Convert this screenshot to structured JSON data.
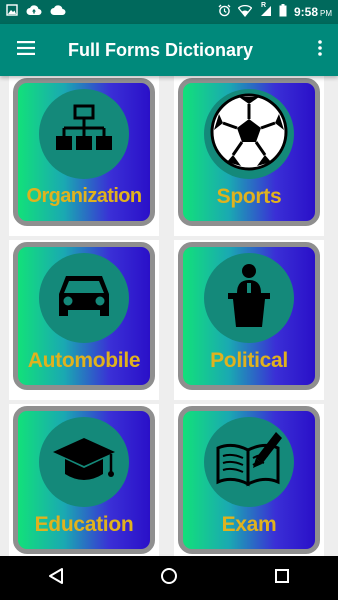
{
  "status_bar": {
    "icons_left": [
      "image-icon",
      "cloud-upload-icon",
      "cloud-icon"
    ],
    "icons_right": [
      "alarm-icon",
      "wifi-icon",
      "signal-icon",
      "battery-icon"
    ],
    "signal_badge": "R",
    "time": "9:58",
    "ampm": "PM"
  },
  "app_bar": {
    "title": "Full Forms Dictionary",
    "menu_icon": "hamburger-menu-icon",
    "overflow_icon": "more-vert-icon"
  },
  "categories": [
    {
      "label": "Organization",
      "icon": "org-chart-icon"
    },
    {
      "label": "Sports",
      "icon": "soccer-ball-icon"
    },
    {
      "label": "Automobile",
      "icon": "car-icon"
    },
    {
      "label": "Political",
      "icon": "podium-speaker-icon"
    },
    {
      "label": "Education",
      "icon": "graduation-cap-icon"
    },
    {
      "label": "Exam",
      "icon": "book-pen-icon"
    }
  ],
  "colors": {
    "status_bar": "#00695c",
    "app_bar": "#00897b",
    "label_gold": "#e0b21e",
    "circle_teal": "#14897a",
    "frame_grey": "#8f8f8f"
  },
  "nav_bar": {
    "icons": [
      "back-icon",
      "home-icon",
      "recents-icon"
    ]
  }
}
